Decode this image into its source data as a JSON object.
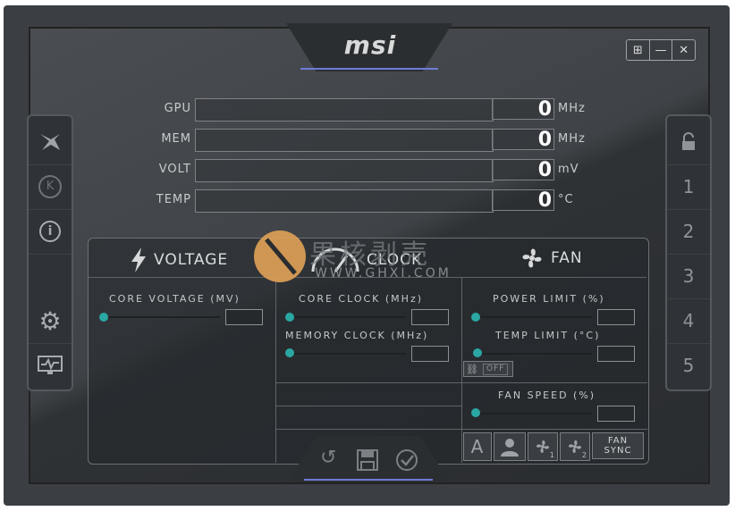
{
  "app": {
    "logo": "msi"
  },
  "window_controls": {
    "windows_label": "⊞",
    "minimize_label": "—",
    "close_label": "✕"
  },
  "left_sidebar": {
    "items": [
      {
        "name": "dragon-icon",
        "glyph": "⚔"
      },
      {
        "name": "k-icon",
        "glyph": "K"
      },
      {
        "name": "info-icon",
        "glyph": "ⓘ"
      },
      {
        "name": "gear-icon",
        "glyph": "⚙"
      },
      {
        "name": "monitor-icon",
        "glyph": "▣"
      }
    ]
  },
  "right_sidebar": {
    "lock_glyph": "🔓",
    "profiles": [
      "1",
      "2",
      "3",
      "4",
      "5"
    ]
  },
  "readouts": [
    {
      "label": "GPU",
      "value": "0",
      "unit": "MHz"
    },
    {
      "label": "MEM",
      "value": "0",
      "unit": "MHz"
    },
    {
      "label": "VOLT",
      "value": "0",
      "unit": "mV"
    },
    {
      "label": "TEMP",
      "value": "0",
      "unit": "°C"
    }
  ],
  "sections": {
    "voltage": {
      "title": "VOLTAGE",
      "core_voltage_label": "CORE VOLTAGE (MV)"
    },
    "clock": {
      "title": "CLOCK",
      "core_clock_label": "CORE CLOCK (MHz)",
      "memory_clock_label": "MEMORY CLOCK (MHz)"
    },
    "fan": {
      "title": "FAN",
      "power_limit_label": "POWER LIMIT (%)",
      "temp_limit_label": "TEMP LIMIT (°C)",
      "link_toggle": "OFF",
      "fan_speed_label": "FAN SPEED (%)",
      "auto_label": "A",
      "fan1_sub": "1",
      "fan2_sub": "2",
      "fan_sync_label": "FAN SYNC"
    }
  },
  "bottom": {
    "reset_glyph": "↺",
    "save_glyph": "💾",
    "apply_glyph": "✓"
  },
  "watermark": {
    "text": "果核剥壳",
    "url": "WWW.GHXI.COM"
  },
  "colors": {
    "accent": "#2aa7a3",
    "frame": "#3b3f43",
    "panel": "#2f3236",
    "logo_accent": "#6f7bd8"
  }
}
